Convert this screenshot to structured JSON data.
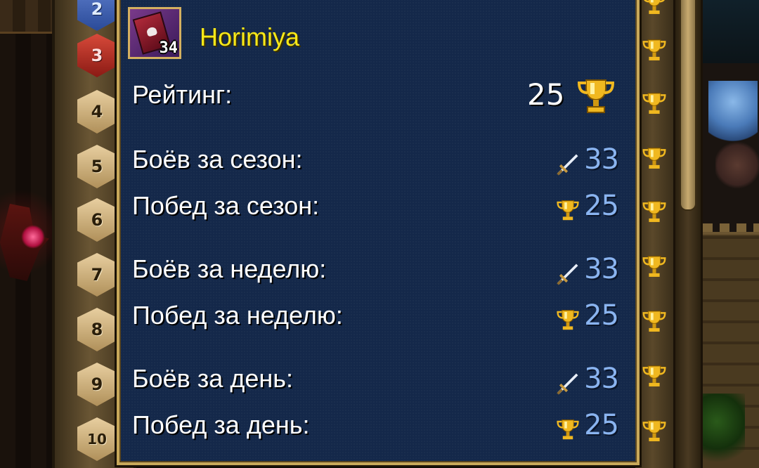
{
  "player": {
    "name": "Horimiya",
    "level": "34"
  },
  "rating": {
    "label": "Рейтинг:",
    "value": "25",
    "icon": "trophy-icon"
  },
  "stats": [
    {
      "label": "Боёв за сезон:",
      "value": "33",
      "icon": "sword-icon"
    },
    {
      "label": "Побед за сезон:",
      "value": "25",
      "icon": "trophy-icon"
    },
    {
      "label": "Боёв за неделю:",
      "value": "33",
      "icon": "sword-icon"
    },
    {
      "label": "Побед за неделю:",
      "value": "25",
      "icon": "trophy-icon"
    },
    {
      "label": "Боёв за день:",
      "value": "33",
      "icon": "sword-icon"
    },
    {
      "label": "Побед за день:",
      "value": "25",
      "icon": "trophy-icon"
    }
  ],
  "ranks": [
    "2",
    "3",
    "4",
    "5",
    "6",
    "7",
    "8",
    "9",
    "10"
  ],
  "colors": {
    "panel_bg": "#14284a",
    "panel_border": "#c8a85a",
    "name": "#f8e818",
    "value_blue": "#8ab4f0",
    "trophy_gold": "#f0b820"
  }
}
